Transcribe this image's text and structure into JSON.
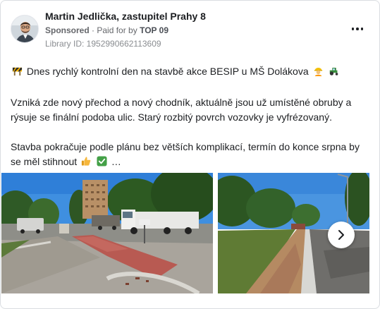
{
  "post": {
    "page_name": "Martin Jedlička, zastupitel Prahy 8",
    "sponsored_label": "Sponsored",
    "separator": "·",
    "paid_for_prefix": "Paid for by",
    "payer": "TOP 09",
    "library_id": "Library ID: 1952990662113609",
    "paragraphs": {
      "p1": "Dnes rychlý kontrolní den na stavbě akce BESIP u MŠ Dolákova",
      "p2": "Vzniká zde nový přechod a nový chodník, aktuálně jsou už umístěné obruby a rýsuje se finální podoba ulic. Starý rozbitý povrch vozovky je vyfrézovaný.",
      "p3": "Stavba pokračuje podle plánu bez větších komplikací, termín do konce srpna by se měl stihnout",
      "p3_ellipsis": "…"
    },
    "icons": {
      "p1_lead": "construction-barrier-icon",
      "p1_trail": [
        "construction-worker-icon",
        "tractor-icon"
      ],
      "p3_trail": [
        "thumbs-up-icon",
        "check-mark-icon"
      ],
      "menu": "more-options-icon",
      "carousel_next": "chevron-right-icon"
    },
    "photos": [
      {
        "subject": "construction-site-crosswalk-photo"
      },
      {
        "subject": "construction-site-curb-photo"
      }
    ]
  }
}
